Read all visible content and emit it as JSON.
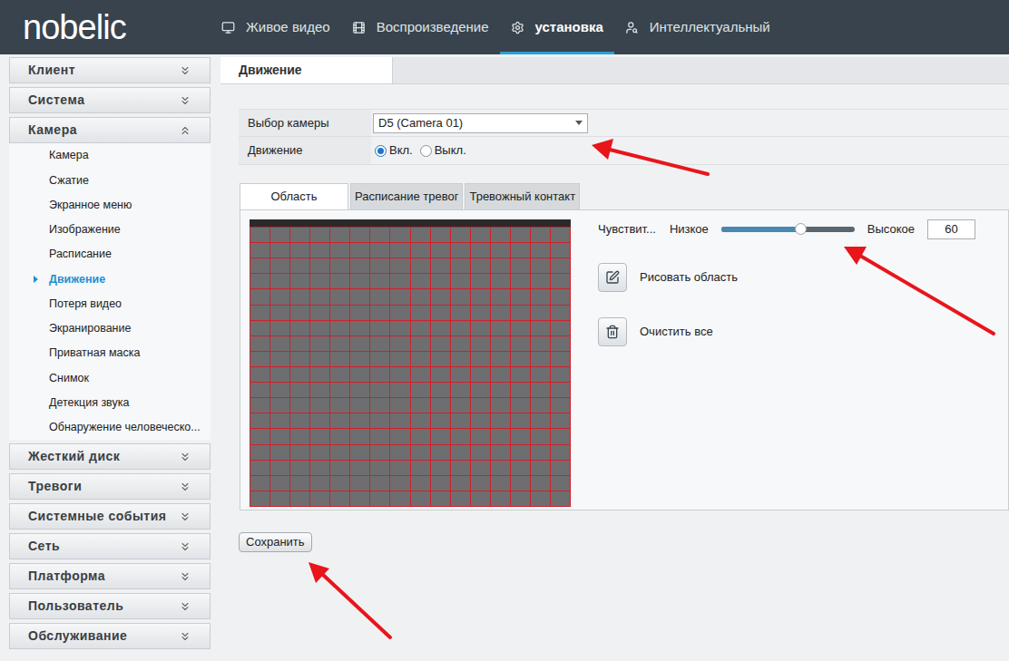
{
  "logo": "nobelic",
  "nav": [
    {
      "label": "Живое видео",
      "selected": false
    },
    {
      "label": "Воспроизведение",
      "selected": false
    },
    {
      "label": "установка",
      "selected": true
    },
    {
      "label": "Интеллектуальный",
      "selected": false
    }
  ],
  "sidebar": [
    {
      "label": "Клиент",
      "expanded": false,
      "items": []
    },
    {
      "label": "Система",
      "expanded": false,
      "items": []
    },
    {
      "label": "Камера",
      "expanded": true,
      "items": [
        {
          "label": "Камера",
          "selected": false
        },
        {
          "label": "Сжатие",
          "selected": false
        },
        {
          "label": "Экранное меню",
          "selected": false
        },
        {
          "label": "Изображение",
          "selected": false
        },
        {
          "label": "Расписание",
          "selected": false
        },
        {
          "label": "Движение",
          "selected": true
        },
        {
          "label": "Потеря видео",
          "selected": false
        },
        {
          "label": "Экранирование",
          "selected": false
        },
        {
          "label": "Приватная маска",
          "selected": false
        },
        {
          "label": "Снимок",
          "selected": false
        },
        {
          "label": "Детекция звука",
          "selected": false
        },
        {
          "label": "Обнаружение человеческо...",
          "selected": false
        }
      ]
    },
    {
      "label": "Жесткий диск",
      "expanded": false,
      "items": []
    },
    {
      "label": "Тревоги",
      "expanded": false,
      "items": []
    },
    {
      "label": "Системные события",
      "expanded": false,
      "items": []
    },
    {
      "label": "Сеть",
      "expanded": false,
      "items": []
    },
    {
      "label": "Платформа",
      "expanded": false,
      "items": []
    },
    {
      "label": "Пользователь",
      "expanded": false,
      "items": []
    },
    {
      "label": "Обслуживание",
      "expanded": false,
      "items": []
    }
  ],
  "page_tab": "Движение",
  "form": {
    "camera_label": "Выбор камеры",
    "camera_value": "D5 (Camera 01)",
    "motion_label": "Движение",
    "options": [
      {
        "label": "Вкл.",
        "selected": true
      },
      {
        "label": "Выкл.",
        "selected": false
      }
    ]
  },
  "subtabs": [
    {
      "label": "Область",
      "selected": true
    },
    {
      "label": "Расписание тревог",
      "selected": false
    },
    {
      "label": "Тревожный контакт",
      "selected": false
    }
  ],
  "area": {
    "columns": 16,
    "rows": 18
  },
  "sensitivity": {
    "label": "Чувствит...",
    "low": "Низкое",
    "high": "Высокое",
    "value": "60",
    "level": 0.6
  },
  "actions": [
    "Рисовать область",
    "Очистить все"
  ],
  "save": "Сохранить"
}
